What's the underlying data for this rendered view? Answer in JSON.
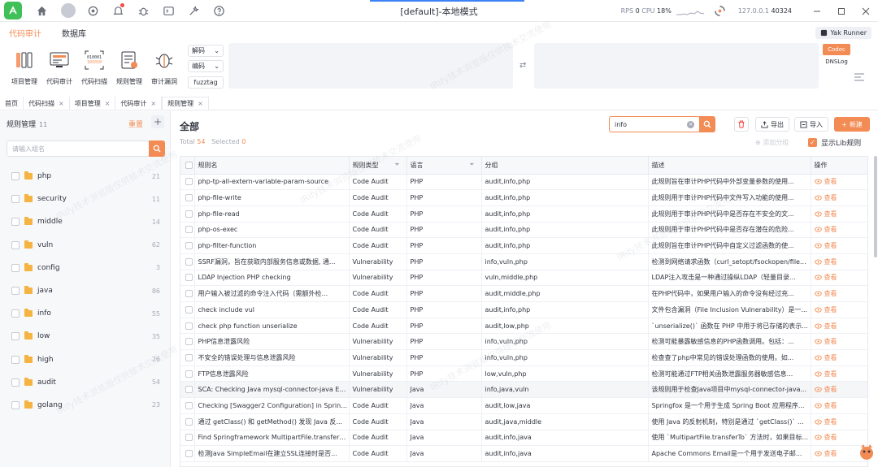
{
  "window": {
    "title": "[default]-本地模式",
    "rps_label": "RPS",
    "rps_value": "0",
    "cpu_label": "CPU",
    "cpu_value": "18%",
    "host": "127.0.0.1",
    "port": "40324"
  },
  "menu": [
    "代码审计",
    "数据库"
  ],
  "yak_runner": "Yak Runner",
  "tools": [
    {
      "label": "项目管理",
      "icon": "project-icon"
    },
    {
      "label": "代码审计",
      "icon": "audit-icon"
    },
    {
      "label": "代码扫描",
      "icon": "scan-icon"
    },
    {
      "label": "规则管理",
      "icon": "rule-icon"
    },
    {
      "label": "审计漏洞",
      "icon": "bug-icon"
    }
  ],
  "codec": {
    "decode": "解码",
    "encode": "编码",
    "fuzztag": "fuzztag",
    "codec_btn": "Codec",
    "dnslog": "DNSLog"
  },
  "page_tabs": [
    "首页",
    "代码扫描",
    "项目管理",
    "代码审计",
    "规则管理"
  ],
  "left": {
    "title": "规则管理",
    "count": "11",
    "reset": "重置",
    "search_placeholder": "请输入组名",
    "groups": [
      {
        "name": "php",
        "count": "21"
      },
      {
        "name": "security",
        "count": "11"
      },
      {
        "name": "middle",
        "count": "14"
      },
      {
        "name": "vuln",
        "count": "62"
      },
      {
        "name": "config",
        "count": "3"
      },
      {
        "name": "java",
        "count": "86"
      },
      {
        "name": "info",
        "count": "55"
      },
      {
        "name": "low",
        "count": "35"
      },
      {
        "name": "high",
        "count": "26"
      },
      {
        "name": "audit",
        "count": "54"
      },
      {
        "name": "golang",
        "count": "23"
      }
    ]
  },
  "main": {
    "title": "全部",
    "total_label": "Total",
    "total": "54",
    "selected_label": "Selected",
    "selected": "0",
    "search_value": "info",
    "export": "导出",
    "import": "导入",
    "new": "新建",
    "add_group": "添加分组",
    "show_lib": "显示Lib规则"
  },
  "table": {
    "headers": [
      "规则名",
      "规则类型",
      "语言",
      "分组",
      "描述",
      "操作"
    ],
    "action": "查看",
    "rows": [
      [
        "php-tp-all-extern-variable-param-source",
        "Code Audit",
        "PHP",
        "audit,info,php",
        "此规则旨在审计PHP代码中外部变量参数的使用..."
      ],
      [
        "php-file-write",
        "Code Audit",
        "PHP",
        "audit,info,php",
        "此规则用于审计PHP代码中文件写入功能的使用..."
      ],
      [
        "php-file-read",
        "Code Audit",
        "PHP",
        "audit,info,php",
        "此规则用于审计PHP代码中是否存在不安全的文..."
      ],
      [
        "php-os-exec",
        "Code Audit",
        "PHP",
        "audit,info,php",
        "此规则用于审计PHP代码中是否存在潜在的危险..."
      ],
      [
        "php-filter-function",
        "Code Audit",
        "PHP",
        "audit,info,php",
        "此规则旨在审计PHP代码中自定义过滤函数的使..."
      ],
      [
        "SSRF漏洞，旨在获取内部服务信息或数据, 通...",
        "Vulnerability",
        "PHP",
        "info,vuln,php",
        "检测到网络请求函数（curl_setopt/fsockopen/file..."
      ],
      [
        "LDAP Injection PHP checking",
        "Vulnerability",
        "PHP",
        "vuln,middle,php",
        "LDAP注入攻击是一种通过操纵LDAP（轻量目录..."
      ],
      [
        "用户输入被过滤的命令注入代码（需额外检...",
        "Code Audit",
        "PHP",
        "audit,middle,php",
        "在PHP代码中，如果用户输入的命令没有经过充..."
      ],
      [
        "check include vul",
        "Code Audit",
        "PHP",
        "audit,info,php",
        "文件包含漏洞（File Inclusion Vulnerability）是一..."
      ],
      [
        "check php function unserialize",
        "Code Audit",
        "PHP",
        "audit,low,php",
        "`unserialize()` 函数在 PHP 中用于将已存储的表示..."
      ],
      [
        "PHP信息泄露风险",
        "Vulnerability",
        "PHP",
        "info,vuln,php",
        "检测可能暴露敏感信息的PHP函数调用。包括：..."
      ],
      [
        "不安全的错误处理与信息泄露风险",
        "Vulnerability",
        "PHP",
        "info,vuln,php",
        "检查查了php中常见的错误处理函数的使用。如..."
      ],
      [
        "FTP信息泄露风险",
        "Vulnerability",
        "PHP",
        "low,vuln,php",
        "检测可能通过FTP相关函数泄露服务器敏感信息..."
      ],
      [
        "SCA: Checking Java mysql-connector-java Exi...",
        "Vulnerability",
        "Java",
        "info,java,vuln",
        "该规则用于检查Java项目中mysql-connector-java..."
      ],
      [
        "Checking [Swagger2 Configuration] in Spring...",
        "Code Audit",
        "Java",
        "audit,low,java",
        "Springfox 是一个用于生成 Spring Boot 应用程序..."
      ],
      [
        "通过 getClass() 和 getMethod() 发现 Java 反...",
        "Code Audit",
        "Java",
        "audit,java,middle",
        "使用 Java 的反射机制，特别是通过 `getClass()` ..."
      ],
      [
        "Find Springframework MultipartFile.transferT...",
        "Code Audit",
        "Java",
        "audit,info,java",
        "使用 `MultipartFile.transferTo` 方法时，如果目标..."
      ],
      [
        "检测Java SimpleEmail在建立SSL连接时是否...",
        "Code Audit",
        "Java",
        "audit,info,java",
        "Apache Commons Email是一个用于发送电子邮..."
      ]
    ]
  },
  "watermark": "IRify技术浏览版仅供技术交流使用",
  "colors": {
    "accent": "#f28b54",
    "logo": "#41c05a",
    "badge": "#f54a45"
  }
}
